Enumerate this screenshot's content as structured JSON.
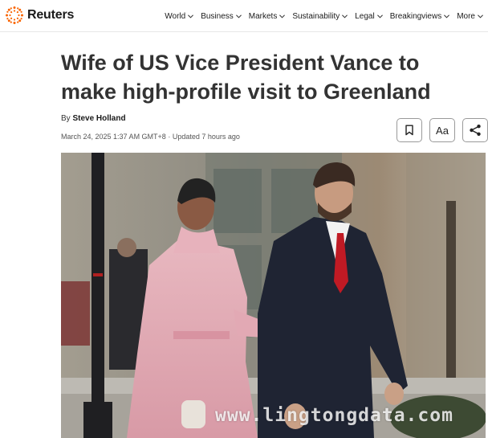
{
  "brand": {
    "name": "Reuters",
    "accent": "#fa6400"
  },
  "nav": [
    {
      "label": "World"
    },
    {
      "label": "Business"
    },
    {
      "label": "Markets"
    },
    {
      "label": "Sustainability"
    },
    {
      "label": "Legal"
    },
    {
      "label": "Breakingviews"
    },
    {
      "label": "More"
    }
  ],
  "article": {
    "headline": "Wife of US Vice President Vance to make high-profile visit to Greenland",
    "byline_prefix": "By ",
    "author": "Steve Holland",
    "dateline": "March 24, 2025 1:37 AM GMT+8 · Updated 7 hours ago"
  },
  "tools": {
    "bookmark_icon": "bookmark-icon",
    "text_size_label": "Aa",
    "share_icon": "share-icon"
  },
  "photo": {
    "watermark": "www.lingtongdata.com"
  }
}
